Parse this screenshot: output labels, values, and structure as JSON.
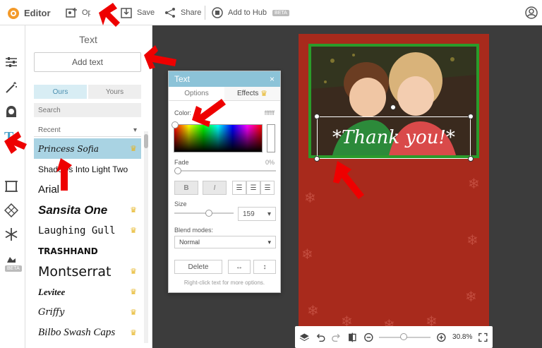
{
  "app": {
    "name": "Editor"
  },
  "toolbar": {
    "open_label": "Open",
    "save_label": "Save",
    "share_label": "Share",
    "hub_label": "Add to Hub",
    "hub_badge": "BETA"
  },
  "iconbar": {
    "beta_badge": "BETA"
  },
  "panel": {
    "title": "Text",
    "add_text": "Add text",
    "tabs": [
      "Ours",
      "Yours"
    ],
    "search_placeholder": "Search",
    "filter": "Recent",
    "fonts": [
      {
        "name": "Princess Sofia",
        "premium": true,
        "selected": true
      },
      {
        "name": "Shadows Into Light Two",
        "premium": false
      },
      {
        "name": "Arial",
        "premium": false
      },
      {
        "name": "Sansita One",
        "premium": true
      },
      {
        "name": "Laughing Gull",
        "premium": true
      },
      {
        "name": "TRASHHAND",
        "premium": false
      },
      {
        "name": "Montserrat",
        "premium": true
      },
      {
        "name": "Levitee",
        "premium": true
      },
      {
        "name": "Griffy",
        "premium": true
      },
      {
        "name": "Bilbo Swash Caps",
        "premium": true
      }
    ]
  },
  "dialog": {
    "title": "Text",
    "tabs": [
      "Options",
      "Effects"
    ],
    "color_label": "Color:",
    "color_value": "ffffff",
    "fade_label": "Fade",
    "fade_value": "0%",
    "fade_level": 0,
    "bold": "B",
    "italic": "I",
    "size_label": "Size",
    "size_value": "159",
    "blend_label": "Blend modes:",
    "blend_value": "Normal",
    "delete_label": "Delete",
    "hint": "Right-click text for more options."
  },
  "canvas": {
    "text": "*Thank you!*",
    "photo_border": "#2a9b2a",
    "card_color": "#a82a1c"
  },
  "zoom": {
    "value": "30.8%"
  },
  "colors": {
    "accent": "#4aa0c8",
    "crown": "#e6b420",
    "dialog_header": "#8cc3d8"
  }
}
